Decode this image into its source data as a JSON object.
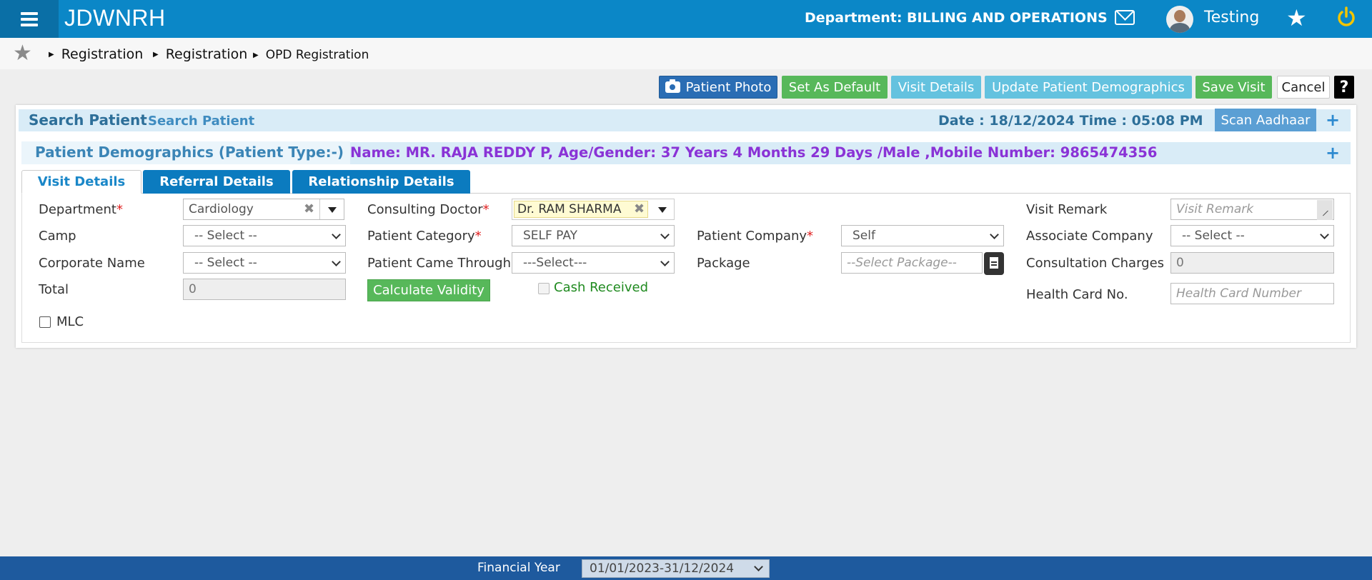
{
  "app": {
    "brand": "JDWNRH"
  },
  "header": {
    "department": "Department: BILLING AND OPERATIONS",
    "username": "Testing",
    "icons": [
      "menu-icon",
      "mail-icon",
      "user-avatar",
      "star-icon",
      "power-icon"
    ]
  },
  "breadcrumb": {
    "items": [
      "Registration",
      "Registration",
      "OPD Registration"
    ]
  },
  "toolbar": {
    "patient_photo": "Patient Photo",
    "set_default": "Set As Default",
    "visit_details": "Visit Details",
    "update_demographics": "Update Patient Demographics",
    "save_visit": "Save Visit",
    "cancel": "Cancel",
    "help": "?"
  },
  "search_patient": {
    "title": "Search Patient",
    "subtitle": "Search Patient",
    "datetime": "Date : 18/12/2024 Time : 05:08 PM",
    "scan_aadhaar": "Scan Aadhaar",
    "expand": "+"
  },
  "demographics": {
    "title": "Patient Demographics (Patient Type:-)",
    "patient_info": "Name: MR. RAJA REDDY P, Age/Gender: 37 Years 4 Months 29 Days /Male ,Mobile Number: 9865474356",
    "expand": "+"
  },
  "tabs": [
    "Visit Details",
    "Referral Details",
    "Relationship Details"
  ],
  "form": {
    "department": {
      "label": "Department",
      "value": "Cardiology"
    },
    "consulting_doctor": {
      "label": "Consulting Doctor",
      "value": "Dr. RAM  SHARMA"
    },
    "visit_remark": {
      "label": "Visit Remark",
      "placeholder": "Visit Remark"
    },
    "camp": {
      "label": "Camp",
      "value": "-- Select --"
    },
    "patient_category": {
      "label": "Patient Category",
      "value": "SELF PAY"
    },
    "patient_company": {
      "label": "Patient Company",
      "value": "Self"
    },
    "associate_company": {
      "label": "Associate Company",
      "value": "-- Select --"
    },
    "corporate_name": {
      "label": "Corporate Name",
      "value": "-- Select --"
    },
    "patient_came_through": {
      "label": "Patient Came Through",
      "value": "---Select---"
    },
    "package": {
      "label": "Package",
      "placeholder": "--Select Package--"
    },
    "consultation_charges": {
      "label": "Consultation Charges",
      "value": "0"
    },
    "total": {
      "label": "Total",
      "value": "0"
    },
    "calculate_validity": "Calculate Validity",
    "cash_received": "Cash Received",
    "health_card": {
      "label": "Health Card No.",
      "placeholder": "Health Card Number"
    },
    "mlc": "MLC",
    "required_mark": "*"
  },
  "footer": {
    "financial_year_label": "Financial Year",
    "financial_year_value": "01/01/2023-31/12/2024"
  },
  "colors": {
    "topbar": "#0b87c7",
    "accent_green": "#57b85a",
    "accent_light_blue": "#64c2df",
    "purple_info": "#8a33d6",
    "footer": "#1e5a9e"
  }
}
